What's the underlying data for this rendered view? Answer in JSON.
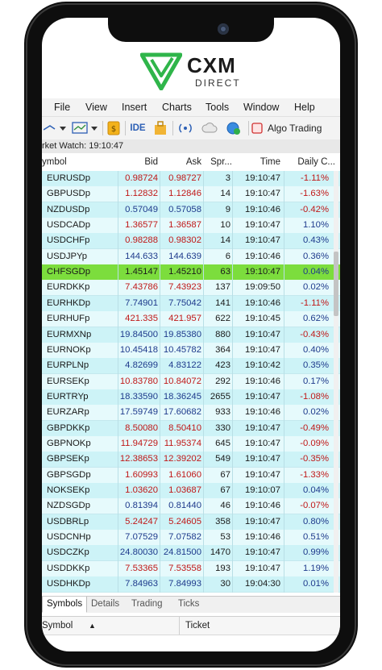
{
  "brand": {
    "name": "CXM",
    "subtitle": "DIRECT",
    "color": "#2fb54a"
  },
  "menu": [
    "File",
    "View",
    "Insert",
    "Charts",
    "Tools",
    "Window",
    "Help"
  ],
  "toolbar": {
    "ide_label": "IDE",
    "algo_label": "Algo Trading"
  },
  "market_watch": {
    "title": "rket Watch: 19:10:47",
    "columns": {
      "symbol": "ymbol",
      "bid": "Bid",
      "ask": "Ask",
      "spread": "Spr...",
      "time": "Time",
      "daily": "Daily C..."
    },
    "colors": {
      "row_bg": "#cdf3f7",
      "row_alt": "#e6fafc",
      "selected": "#7cdd3d",
      "up": "#1e3a8c",
      "down": "#c01818"
    },
    "rows": [
      {
        "symbol": "EURUSDp",
        "bid": "0.98724",
        "ask": "0.98727",
        "spread": "3",
        "time": "19:10:47",
        "daily": "-1.11%",
        "dir": "down"
      },
      {
        "symbol": "GBPUSDp",
        "bid": "1.12832",
        "ask": "1.12846",
        "spread": "14",
        "time": "19:10:47",
        "daily": "-1.63%",
        "dir": "down"
      },
      {
        "symbol": "NZDUSDp",
        "bid": "0.57049",
        "ask": "0.57058",
        "spread": "9",
        "time": "19:10:46",
        "daily": "-0.42%",
        "dir": "up"
      },
      {
        "symbol": "USDCADp",
        "bid": "1.36577",
        "ask": "1.36587",
        "spread": "10",
        "time": "19:10:47",
        "daily": "1.10%",
        "dir": "down"
      },
      {
        "symbol": "USDCHFp",
        "bid": "0.98288",
        "ask": "0.98302",
        "spread": "14",
        "time": "19:10:47",
        "daily": "0.43%",
        "dir": "down"
      },
      {
        "symbol": "USDJPYp",
        "bid": "144.633",
        "ask": "144.639",
        "spread": "6",
        "time": "19:10:46",
        "daily": "0.36%",
        "dir": "up"
      },
      {
        "symbol": "CHFSGDp",
        "bid": "1.45147",
        "ask": "1.45210",
        "spread": "63",
        "time": "19:10:47",
        "daily": "0.04%",
        "dir": "down",
        "selected": true
      },
      {
        "symbol": "EURDKKp",
        "bid": "7.43786",
        "ask": "7.43923",
        "spread": "137",
        "time": "19:09:50",
        "daily": "0.02%",
        "dir": "down"
      },
      {
        "symbol": "EURHKDp",
        "bid": "7.74901",
        "ask": "7.75042",
        "spread": "141",
        "time": "19:10:46",
        "daily": "-1.11%",
        "dir": "up"
      },
      {
        "symbol": "EURHUFp",
        "bid": "421.335",
        "ask": "421.957",
        "spread": "622",
        "time": "19:10:45",
        "daily": "0.62%",
        "dir": "down"
      },
      {
        "symbol": "EURMXNp",
        "bid": "19.84500",
        "ask": "19.85380",
        "spread": "880",
        "time": "19:10:47",
        "daily": "-0.43%",
        "dir": "up"
      },
      {
        "symbol": "EURNOKp",
        "bid": "10.45418",
        "ask": "10.45782",
        "spread": "364",
        "time": "19:10:47",
        "daily": "0.40%",
        "dir": "up"
      },
      {
        "symbol": "EURPLNp",
        "bid": "4.82699",
        "ask": "4.83122",
        "spread": "423",
        "time": "19:10:42",
        "daily": "0.35%",
        "dir": "up"
      },
      {
        "symbol": "EURSEKp",
        "bid": "10.83780",
        "ask": "10.84072",
        "spread": "292",
        "time": "19:10:46",
        "daily": "0.17%",
        "dir": "down"
      },
      {
        "symbol": "EURTRYp",
        "bid": "18.33590",
        "ask": "18.36245",
        "spread": "2655",
        "time": "19:10:47",
        "daily": "-1.08%",
        "dir": "up"
      },
      {
        "symbol": "EURZARp",
        "bid": "17.59749",
        "ask": "17.60682",
        "spread": "933",
        "time": "19:10:46",
        "daily": "0.02%",
        "dir": "up"
      },
      {
        "symbol": "GBPDKKp",
        "bid": "8.50080",
        "ask": "8.50410",
        "spread": "330",
        "time": "19:10:47",
        "daily": "-0.49%",
        "dir": "down"
      },
      {
        "symbol": "GBPNOKp",
        "bid": "11.94729",
        "ask": "11.95374",
        "spread": "645",
        "time": "19:10:47",
        "daily": "-0.09%",
        "dir": "down"
      },
      {
        "symbol": "GBPSEKp",
        "bid": "12.38653",
        "ask": "12.39202",
        "spread": "549",
        "time": "19:10:47",
        "daily": "-0.35%",
        "dir": "down"
      },
      {
        "symbol": "GBPSGDp",
        "bid": "1.60993",
        "ask": "1.61060",
        "spread": "67",
        "time": "19:10:47",
        "daily": "-1.33%",
        "dir": "down"
      },
      {
        "symbol": "NOKSEKp",
        "bid": "1.03620",
        "ask": "1.03687",
        "spread": "67",
        "time": "19:10:07",
        "daily": "0.04%",
        "dir": "down"
      },
      {
        "symbol": "NZDSGDp",
        "bid": "0.81394",
        "ask": "0.81440",
        "spread": "46",
        "time": "19:10:46",
        "daily": "-0.07%",
        "dir": "up"
      },
      {
        "symbol": "USDBRLp",
        "bid": "5.24247",
        "ask": "5.24605",
        "spread": "358",
        "time": "19:10:47",
        "daily": "0.80%",
        "dir": "down"
      },
      {
        "symbol": "USDCNHp",
        "bid": "7.07529",
        "ask": "7.07582",
        "spread": "53",
        "time": "19:10:46",
        "daily": "0.51%",
        "dir": "up"
      },
      {
        "symbol": "USDCZKp",
        "bid": "24.80030",
        "ask": "24.81500",
        "spread": "1470",
        "time": "19:10:47",
        "daily": "0.99%",
        "dir": "up"
      },
      {
        "symbol": "USDDKKp",
        "bid": "7.53365",
        "ask": "7.53558",
        "spread": "193",
        "time": "19:10:47",
        "daily": "1.19%",
        "dir": "down"
      },
      {
        "symbol": "USDHKDp",
        "bid": "7.84963",
        "ask": "7.84993",
        "spread": "30",
        "time": "19:04:30",
        "daily": "0.01%",
        "dir": "up"
      }
    ]
  },
  "tabs": [
    {
      "label": "Symbols",
      "active": true
    },
    {
      "label": "Details",
      "active": false
    },
    {
      "label": "Trading",
      "active": false
    },
    {
      "label": "Ticks",
      "active": false
    }
  ],
  "bottom": {
    "symbol_header": "Symbol",
    "ticket_header": "Ticket"
  }
}
